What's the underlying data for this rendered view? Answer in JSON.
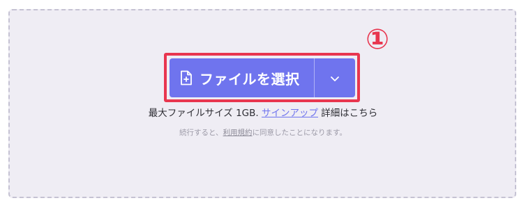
{
  "upload": {
    "step_marker": "①",
    "select_file_label": "ファイルを選択",
    "max_size_text": "最大ファイルサイズ 1GB.",
    "signup_link": "サインアップ",
    "details_text": "詳細はこちら",
    "terms_prefix": "続行すると、",
    "terms_link": "利用規約",
    "terms_suffix": "に同意したことになります。"
  },
  "icons": {
    "file": "file-plus-icon",
    "dropdown": "chevron-down-icon"
  },
  "colors": {
    "button_bg": "#6f74ee",
    "highlight": "#e8364f",
    "dropzone_bg": "#efedf4",
    "link": "#6f74ee"
  }
}
